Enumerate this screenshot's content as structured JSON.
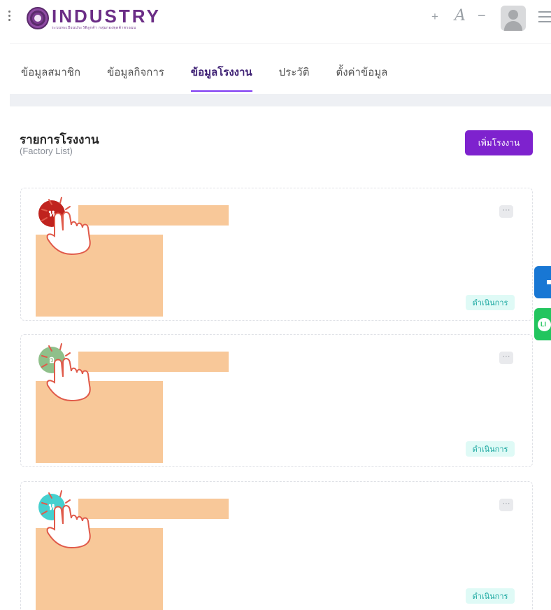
{
  "header": {
    "logo_title": "INDUSTRY",
    "logo_subtitle": "ระบบทะเบียนประวัติลูกค้า กลุ่มกองพุดค้าทรอมม",
    "font_increase": "+",
    "font_label": "A",
    "font_decrease": "−"
  },
  "tabs": [
    {
      "label": "ข้อมูลสมาชิก",
      "active": false
    },
    {
      "label": "ข้อมูลกิจการ",
      "active": false
    },
    {
      "label": "ข้อมูลโรงงาน",
      "active": true
    },
    {
      "label": "ประวัติ",
      "active": false
    },
    {
      "label": "ตั้งค่าข้อมูล",
      "active": false
    }
  ],
  "section": {
    "title": "รายการโรงงาน",
    "subtitle": "(Factory List)",
    "add_button": "เพิ่มโรงงาน"
  },
  "factories": [
    {
      "avatar_letter": "ห",
      "avatar_color": "#c0231e",
      "more_label": "···",
      "status": "ดำเนินการ"
    },
    {
      "avatar_letter": "อ",
      "avatar_color": "#8fc08a",
      "more_label": "···",
      "status": "ดำเนินการ"
    },
    {
      "avatar_letter": "ห",
      "avatar_color": "#45d0cf",
      "more_label": "···",
      "status": "ดำเนินการ"
    }
  ],
  "floating": {
    "line_label": "LI"
  },
  "colors": {
    "accent": "#7e22ce",
    "tab_indicator": "#7e3af2",
    "redaction": "#f8c899",
    "status_bg": "#dffaf6",
    "status_text": "#1aa7a0"
  }
}
